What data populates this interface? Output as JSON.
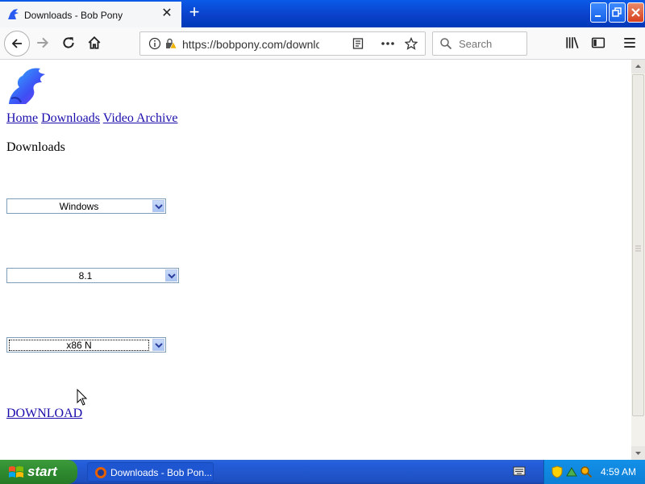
{
  "browser": {
    "tab_title": "Downloads - Bob Pony",
    "url": "https://bobpony.com/downloads",
    "search_placeholder": "Search"
  },
  "page": {
    "nav": [
      "Home",
      "Downloads",
      "Video Archive"
    ],
    "heading": "Downloads",
    "selects": {
      "os": "Windows",
      "version": "8.1",
      "arch": "x86 N"
    },
    "download_link": "DOWNLOAD"
  },
  "taskbar": {
    "start_label": "start",
    "task_label": "Downloads - Bob Pon...",
    "clock": "4:59 AM"
  },
  "icons": {
    "logo": "pony-logo-icon",
    "back": "back-arrow-icon",
    "forward": "forward-arrow-icon",
    "reload": "reload-icon",
    "home": "home-icon",
    "info": "info-icon",
    "lock": "lock-warning-icon",
    "reader": "reader-view-icon",
    "more": "more-dots-icon",
    "bookmark": "star-icon",
    "library": "library-icon",
    "sidebar": "sidebar-icon",
    "menu": "hamburger-menu-icon"
  },
  "colors": {
    "link": "#1a0dab",
    "titlebar": "#0a3fc8",
    "taskbar": "#245edb",
    "start": "#2f8a2f"
  }
}
